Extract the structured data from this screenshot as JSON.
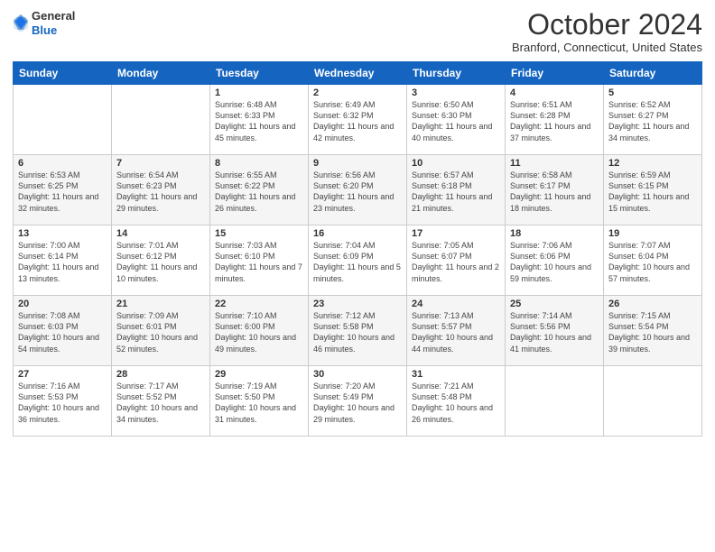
{
  "logo": {
    "general": "General",
    "blue": "Blue"
  },
  "title": "October 2024",
  "location": "Branford, Connecticut, United States",
  "days_of_week": [
    "Sunday",
    "Monday",
    "Tuesday",
    "Wednesday",
    "Thursday",
    "Friday",
    "Saturday"
  ],
  "weeks": [
    [
      {
        "day": "",
        "info": ""
      },
      {
        "day": "",
        "info": ""
      },
      {
        "day": "1",
        "info": "Sunrise: 6:48 AM\nSunset: 6:33 PM\nDaylight: 11 hours and 45 minutes."
      },
      {
        "day": "2",
        "info": "Sunrise: 6:49 AM\nSunset: 6:32 PM\nDaylight: 11 hours and 42 minutes."
      },
      {
        "day": "3",
        "info": "Sunrise: 6:50 AM\nSunset: 6:30 PM\nDaylight: 11 hours and 40 minutes."
      },
      {
        "day": "4",
        "info": "Sunrise: 6:51 AM\nSunset: 6:28 PM\nDaylight: 11 hours and 37 minutes."
      },
      {
        "day": "5",
        "info": "Sunrise: 6:52 AM\nSunset: 6:27 PM\nDaylight: 11 hours and 34 minutes."
      }
    ],
    [
      {
        "day": "6",
        "info": "Sunrise: 6:53 AM\nSunset: 6:25 PM\nDaylight: 11 hours and 32 minutes."
      },
      {
        "day": "7",
        "info": "Sunrise: 6:54 AM\nSunset: 6:23 PM\nDaylight: 11 hours and 29 minutes."
      },
      {
        "day": "8",
        "info": "Sunrise: 6:55 AM\nSunset: 6:22 PM\nDaylight: 11 hours and 26 minutes."
      },
      {
        "day": "9",
        "info": "Sunrise: 6:56 AM\nSunset: 6:20 PM\nDaylight: 11 hours and 23 minutes."
      },
      {
        "day": "10",
        "info": "Sunrise: 6:57 AM\nSunset: 6:18 PM\nDaylight: 11 hours and 21 minutes."
      },
      {
        "day": "11",
        "info": "Sunrise: 6:58 AM\nSunset: 6:17 PM\nDaylight: 11 hours and 18 minutes."
      },
      {
        "day": "12",
        "info": "Sunrise: 6:59 AM\nSunset: 6:15 PM\nDaylight: 11 hours and 15 minutes."
      }
    ],
    [
      {
        "day": "13",
        "info": "Sunrise: 7:00 AM\nSunset: 6:14 PM\nDaylight: 11 hours and 13 minutes."
      },
      {
        "day": "14",
        "info": "Sunrise: 7:01 AM\nSunset: 6:12 PM\nDaylight: 11 hours and 10 minutes."
      },
      {
        "day": "15",
        "info": "Sunrise: 7:03 AM\nSunset: 6:10 PM\nDaylight: 11 hours and 7 minutes."
      },
      {
        "day": "16",
        "info": "Sunrise: 7:04 AM\nSunset: 6:09 PM\nDaylight: 11 hours and 5 minutes."
      },
      {
        "day": "17",
        "info": "Sunrise: 7:05 AM\nSunset: 6:07 PM\nDaylight: 11 hours and 2 minutes."
      },
      {
        "day": "18",
        "info": "Sunrise: 7:06 AM\nSunset: 6:06 PM\nDaylight: 10 hours and 59 minutes."
      },
      {
        "day": "19",
        "info": "Sunrise: 7:07 AM\nSunset: 6:04 PM\nDaylight: 10 hours and 57 minutes."
      }
    ],
    [
      {
        "day": "20",
        "info": "Sunrise: 7:08 AM\nSunset: 6:03 PM\nDaylight: 10 hours and 54 minutes."
      },
      {
        "day": "21",
        "info": "Sunrise: 7:09 AM\nSunset: 6:01 PM\nDaylight: 10 hours and 52 minutes."
      },
      {
        "day": "22",
        "info": "Sunrise: 7:10 AM\nSunset: 6:00 PM\nDaylight: 10 hours and 49 minutes."
      },
      {
        "day": "23",
        "info": "Sunrise: 7:12 AM\nSunset: 5:58 PM\nDaylight: 10 hours and 46 minutes."
      },
      {
        "day": "24",
        "info": "Sunrise: 7:13 AM\nSunset: 5:57 PM\nDaylight: 10 hours and 44 minutes."
      },
      {
        "day": "25",
        "info": "Sunrise: 7:14 AM\nSunset: 5:56 PM\nDaylight: 10 hours and 41 minutes."
      },
      {
        "day": "26",
        "info": "Sunrise: 7:15 AM\nSunset: 5:54 PM\nDaylight: 10 hours and 39 minutes."
      }
    ],
    [
      {
        "day": "27",
        "info": "Sunrise: 7:16 AM\nSunset: 5:53 PM\nDaylight: 10 hours and 36 minutes."
      },
      {
        "day": "28",
        "info": "Sunrise: 7:17 AM\nSunset: 5:52 PM\nDaylight: 10 hours and 34 minutes."
      },
      {
        "day": "29",
        "info": "Sunrise: 7:19 AM\nSunset: 5:50 PM\nDaylight: 10 hours and 31 minutes."
      },
      {
        "day": "30",
        "info": "Sunrise: 7:20 AM\nSunset: 5:49 PM\nDaylight: 10 hours and 29 minutes."
      },
      {
        "day": "31",
        "info": "Sunrise: 7:21 AM\nSunset: 5:48 PM\nDaylight: 10 hours and 26 minutes."
      },
      {
        "day": "",
        "info": ""
      },
      {
        "day": "",
        "info": ""
      }
    ]
  ]
}
